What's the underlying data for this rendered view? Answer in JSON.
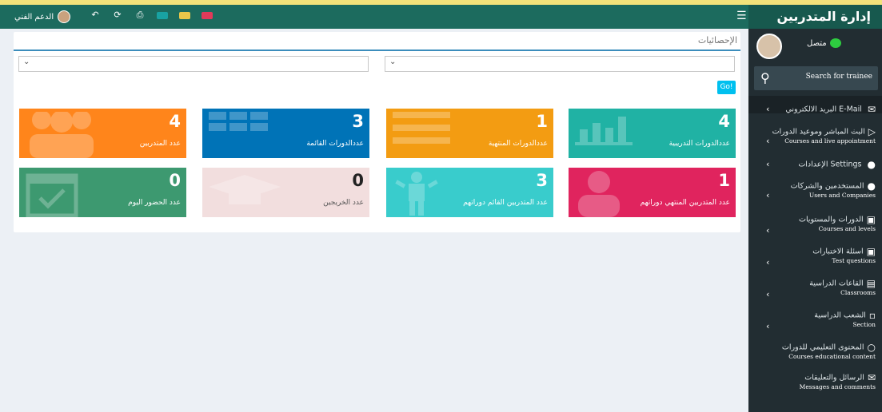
{
  "header": {
    "brand": "إدارة المتدربين",
    "support_label": "الدعم الفني",
    "hamburger_icon": "menu-icon",
    "toolbar_icons": [
      "reply-icon",
      "refresh-icon",
      "print-icon",
      "mail-icon",
      "bell-icon",
      "flag-icon"
    ]
  },
  "sidebar": {
    "status_label": "متصل",
    "search_placeholder": "Search for trainee",
    "items": [
      {
        "ar": "البريد الالكتروني E-Mail",
        "en": "",
        "icon": "envelope-icon"
      },
      {
        "ar": "البث المباشر وموعيد الدورات",
        "en": "Courses and live appointment",
        "icon": "play-box-icon"
      },
      {
        "ar": "الإعدادات Settings",
        "en": "",
        "icon": "users-icon"
      },
      {
        "ar": "المستخدمين والشركات",
        "en": "Users and Companies",
        "icon": "users-icon"
      },
      {
        "ar": "الدورات والمستويات",
        "en": "Courses and levels",
        "icon": "calendar-icon"
      },
      {
        "ar": "اسئلة الاختبارات",
        "en": "Test questions",
        "icon": "calendar-icon"
      },
      {
        "ar": "القاعات الدراسية",
        "en": "Classrooms",
        "icon": "grid-icon"
      },
      {
        "ar": "الشعب الدراسية",
        "en": "Section",
        "icon": "bar-chart-icon"
      },
      {
        "ar": "المحتوى التعليمي للدورات",
        "en": "Courses educational content",
        "icon": "circle-icon"
      },
      {
        "ar": "الرسائل والتعليقات",
        "en": "Messages and comments",
        "icon": "envelope-icon"
      }
    ]
  },
  "content": {
    "title": "الإحصائيات",
    "go_label": "Go!",
    "tiles": [
      {
        "value": "4",
        "label": "عدد المتدربين",
        "color": "#ff851b",
        "icon": "users-icon"
      },
      {
        "value": "3",
        "label": "عددالدورات القائمة",
        "color": "#0073b7",
        "icon": "grid-icon"
      },
      {
        "value": "1",
        "label": "عددالدورات المنتهية",
        "color": "#f39c12",
        "icon": "list-icon"
      },
      {
        "value": "4",
        "label": "عددالدورات التدريبية",
        "color": "#20b2a4",
        "icon": "bar-chart-icon"
      },
      {
        "value": "0",
        "label": "عدد الحضور اليوم",
        "color": "#3d9970",
        "icon": "calendar-check-icon"
      },
      {
        "value": "0",
        "label": "عدد الخريجين",
        "color": "#f2dede",
        "icon": "graduation-cap-icon"
      },
      {
        "value": "3",
        "label": "عدد المتدربين القائم دوراتهم",
        "color": "#39cccc",
        "icon": "child-icon"
      },
      {
        "value": "1",
        "label": "عدد المتدربين المنتهي دوراتهم",
        "color": "#e0245e",
        "icon": "user-icon"
      }
    ]
  }
}
